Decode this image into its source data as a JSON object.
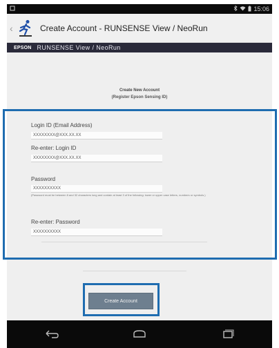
{
  "status": {
    "time": "15:06",
    "icons": [
      "sim-icon",
      "bluetooth-icon",
      "wifi-icon",
      "battery-icon"
    ]
  },
  "action_bar": {
    "title": "Create Account - RUNSENSE View / NeoRun",
    "icon": "runner-icon"
  },
  "brand_bar": {
    "logo": "EPSON",
    "title": "RUNSENSE View / NeoRun"
  },
  "form": {
    "heading": "Create New Account",
    "subheading": "(Register Epson Sensing ID)",
    "login_id_label": "Login ID (Email Address)",
    "login_id_value": "XXXXXXXX@XXX.XX.XX",
    "reenter_login_label": "Re-enter: Login ID",
    "reenter_login_value": "XXXXXXXX@XXX.XX.XX",
    "password_label": "Password",
    "password_value": "XXXXXXXXXX",
    "password_hint": "(Password must be between 8 and 32 characters long and contain at least 3 of the following: lower or upper case letters, numbers or symbols.)",
    "reenter_password_label": "Re-enter: Password",
    "reenter_password_value": "XXXXXXXXXX"
  },
  "create_button": {
    "label": "Create Account"
  },
  "highlight_color": "#1e6cb0",
  "nav": {
    "icons": [
      "back-icon",
      "home-icon",
      "recents-icon"
    ]
  }
}
